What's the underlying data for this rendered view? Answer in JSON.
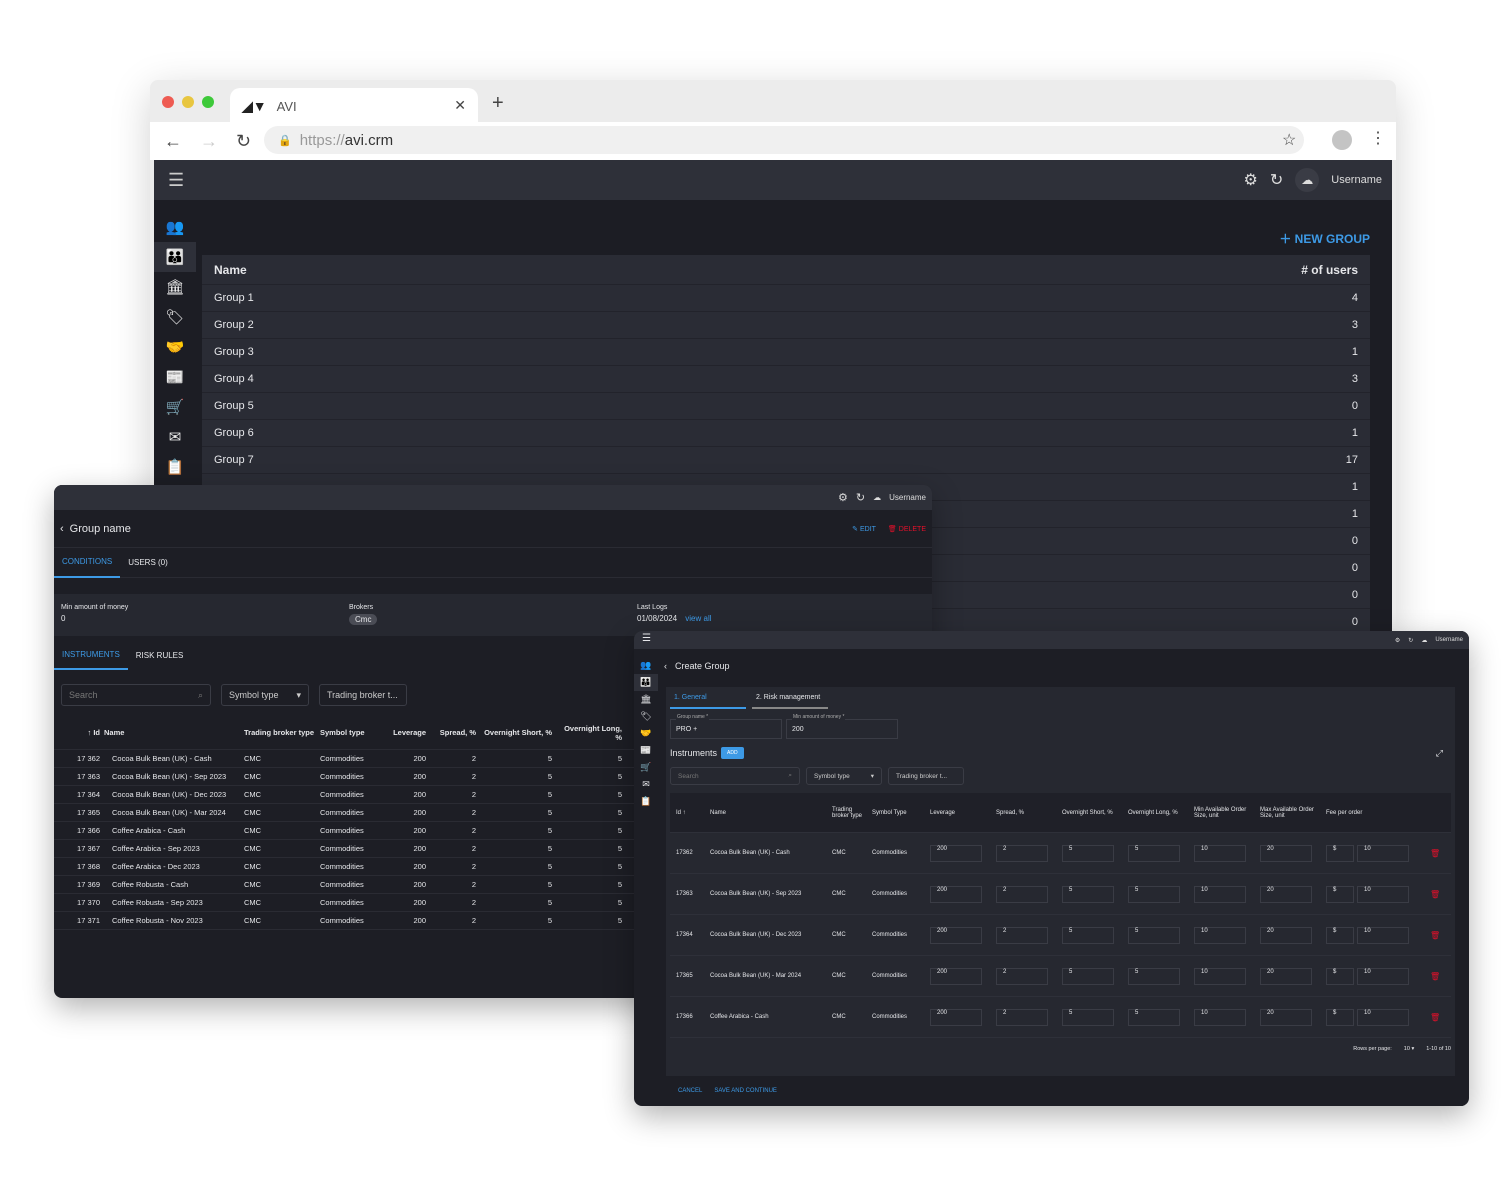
{
  "browser": {
    "tab_title": "AVI",
    "url_prefix": "https://",
    "url_host": "avi.crm"
  },
  "header": {
    "username": "Username"
  },
  "main": {
    "new_group": "NEW GROUP",
    "col_name": "Name",
    "col_users": "# of users",
    "groups": [
      {
        "n": "Group 1",
        "u": "4"
      },
      {
        "n": "Group 2",
        "u": "3"
      },
      {
        "n": "Group 3",
        "u": "1"
      },
      {
        "n": "Group 4",
        "u": "3"
      },
      {
        "n": "Group 5",
        "u": "0"
      },
      {
        "n": "Group 6",
        "u": "1"
      },
      {
        "n": "Group 7",
        "u": "17"
      },
      {
        "n": "",
        "u": "1"
      },
      {
        "n": "",
        "u": "1"
      },
      {
        "n": "",
        "u": "0"
      },
      {
        "n": "",
        "u": "0"
      },
      {
        "n": "",
        "u": "0"
      },
      {
        "n": "",
        "u": "0"
      }
    ]
  },
  "detail": {
    "title": "Group name",
    "edit": "EDIT",
    "delete": "DELETE",
    "tab_conditions": "CONDITIONS",
    "tab_users": "USERS (0)",
    "min_label": "Min amount of money",
    "min_value": "0",
    "brokers_label": "Brokers",
    "broker": "Cmc",
    "logs_label": "Last Logs",
    "logs_date": "01/08/2024",
    "view_all": "view all",
    "tab_instruments": "INSTRUMENTS",
    "tab_risk": "RISK RULES",
    "search": "Search",
    "symbol_type": "Symbol type",
    "broker_type": "Trading broker t...",
    "columns": [
      "↑ Id",
      "Name",
      "Trading broker type",
      "Symbol type",
      "Leverage",
      "Spread, %",
      "Overnight Short, %",
      "Overnight Long, %"
    ],
    "rows": [
      [
        "17 362",
        "Cocoa Bulk Bean (UK) - Cash"
      ],
      [
        "17 363",
        "Cocoa Bulk Bean (UK) - Sep 2023"
      ],
      [
        "17 364",
        "Cocoa Bulk Bean (UK) - Dec 2023"
      ],
      [
        "17 365",
        "Cocoa Bulk Bean (UK) - Mar 2024"
      ],
      [
        "17 366",
        "Coffee Arabica - Cash"
      ],
      [
        "17 367",
        "Coffee Arabica - Sep 2023"
      ],
      [
        "17 368",
        "Coffee Arabica - Dec 2023"
      ],
      [
        "17 369",
        "Coffee Robusta - Cash"
      ],
      [
        "17 370",
        "Coffee Robusta - Sep 2023"
      ],
      [
        "17 371",
        "Coffee Robusta - Nov 2023"
      ]
    ],
    "common": {
      "broker": "CMC",
      "symbol": "Commodities",
      "leverage": "200",
      "spread": "2",
      "short": "5",
      "long": "5"
    }
  },
  "create": {
    "title": "Create Group",
    "step1": "1. General",
    "step2": "2. Risk management",
    "name_label": "Group name *",
    "name_value": "PRO +",
    "min_label": "Min amount of money *",
    "min_value": "200",
    "instruments": "Instruments",
    "add": "ADD",
    "search": "Search",
    "symbol_type": "Symbol type",
    "broker_type": "Trading broker t...",
    "columns": [
      "Id ↑",
      "Name",
      "Trading broker type",
      "Symbol Type",
      "Leverage",
      "Spread, %",
      "Overnight Short, %",
      "Overnight Long, %",
      "Min Available Order Size, unit",
      "Max Available Order Size, unit",
      "Fee per order"
    ],
    "rows": [
      [
        "17362",
        "Cocoa Bulk Bean (UK) - Cash"
      ],
      [
        "17363",
        "Cocoa Bulk Bean (UK) - Sep 2023"
      ],
      [
        "17364",
        "Cocoa Bulk Bean (UK) - Dec 2023"
      ],
      [
        "17365",
        "Cocoa Bulk Bean (UK) - Mar 2024"
      ],
      [
        "17366",
        "Coffee Arabica - Cash"
      ]
    ],
    "values": {
      "broker": "CMC",
      "symbol": "Commodities",
      "leverage": "200",
      "spread": "2",
      "short": "5",
      "long": "5",
      "min": "10",
      "max": "20",
      "currency": "$",
      "fee": "10"
    },
    "rows_per_page_label": "Rows per page:",
    "rows_per_page": "10",
    "range": "1-10 of 10",
    "cancel": "CANCEL",
    "save": "SAVE AND CONTINUE"
  }
}
